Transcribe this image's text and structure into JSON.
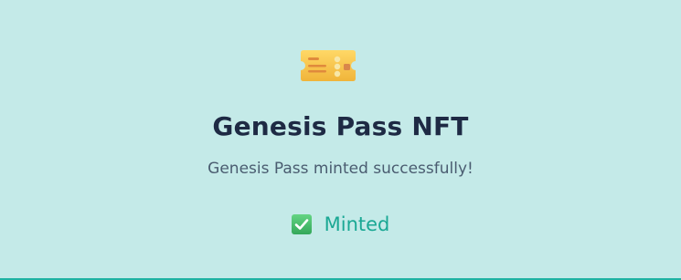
{
  "card": {
    "icon": "ticket-icon",
    "title": "Genesis Pass NFT",
    "message": "Genesis Pass minted successfully!",
    "status": {
      "icon": "check-mark-button-icon",
      "label": "Minted"
    }
  },
  "colors": {
    "background": "#c4eae8",
    "title": "#1e2a44",
    "message": "#4a5c70",
    "status": "#1aa894",
    "ticket": "#f6c445",
    "check": "#3fbf67"
  }
}
